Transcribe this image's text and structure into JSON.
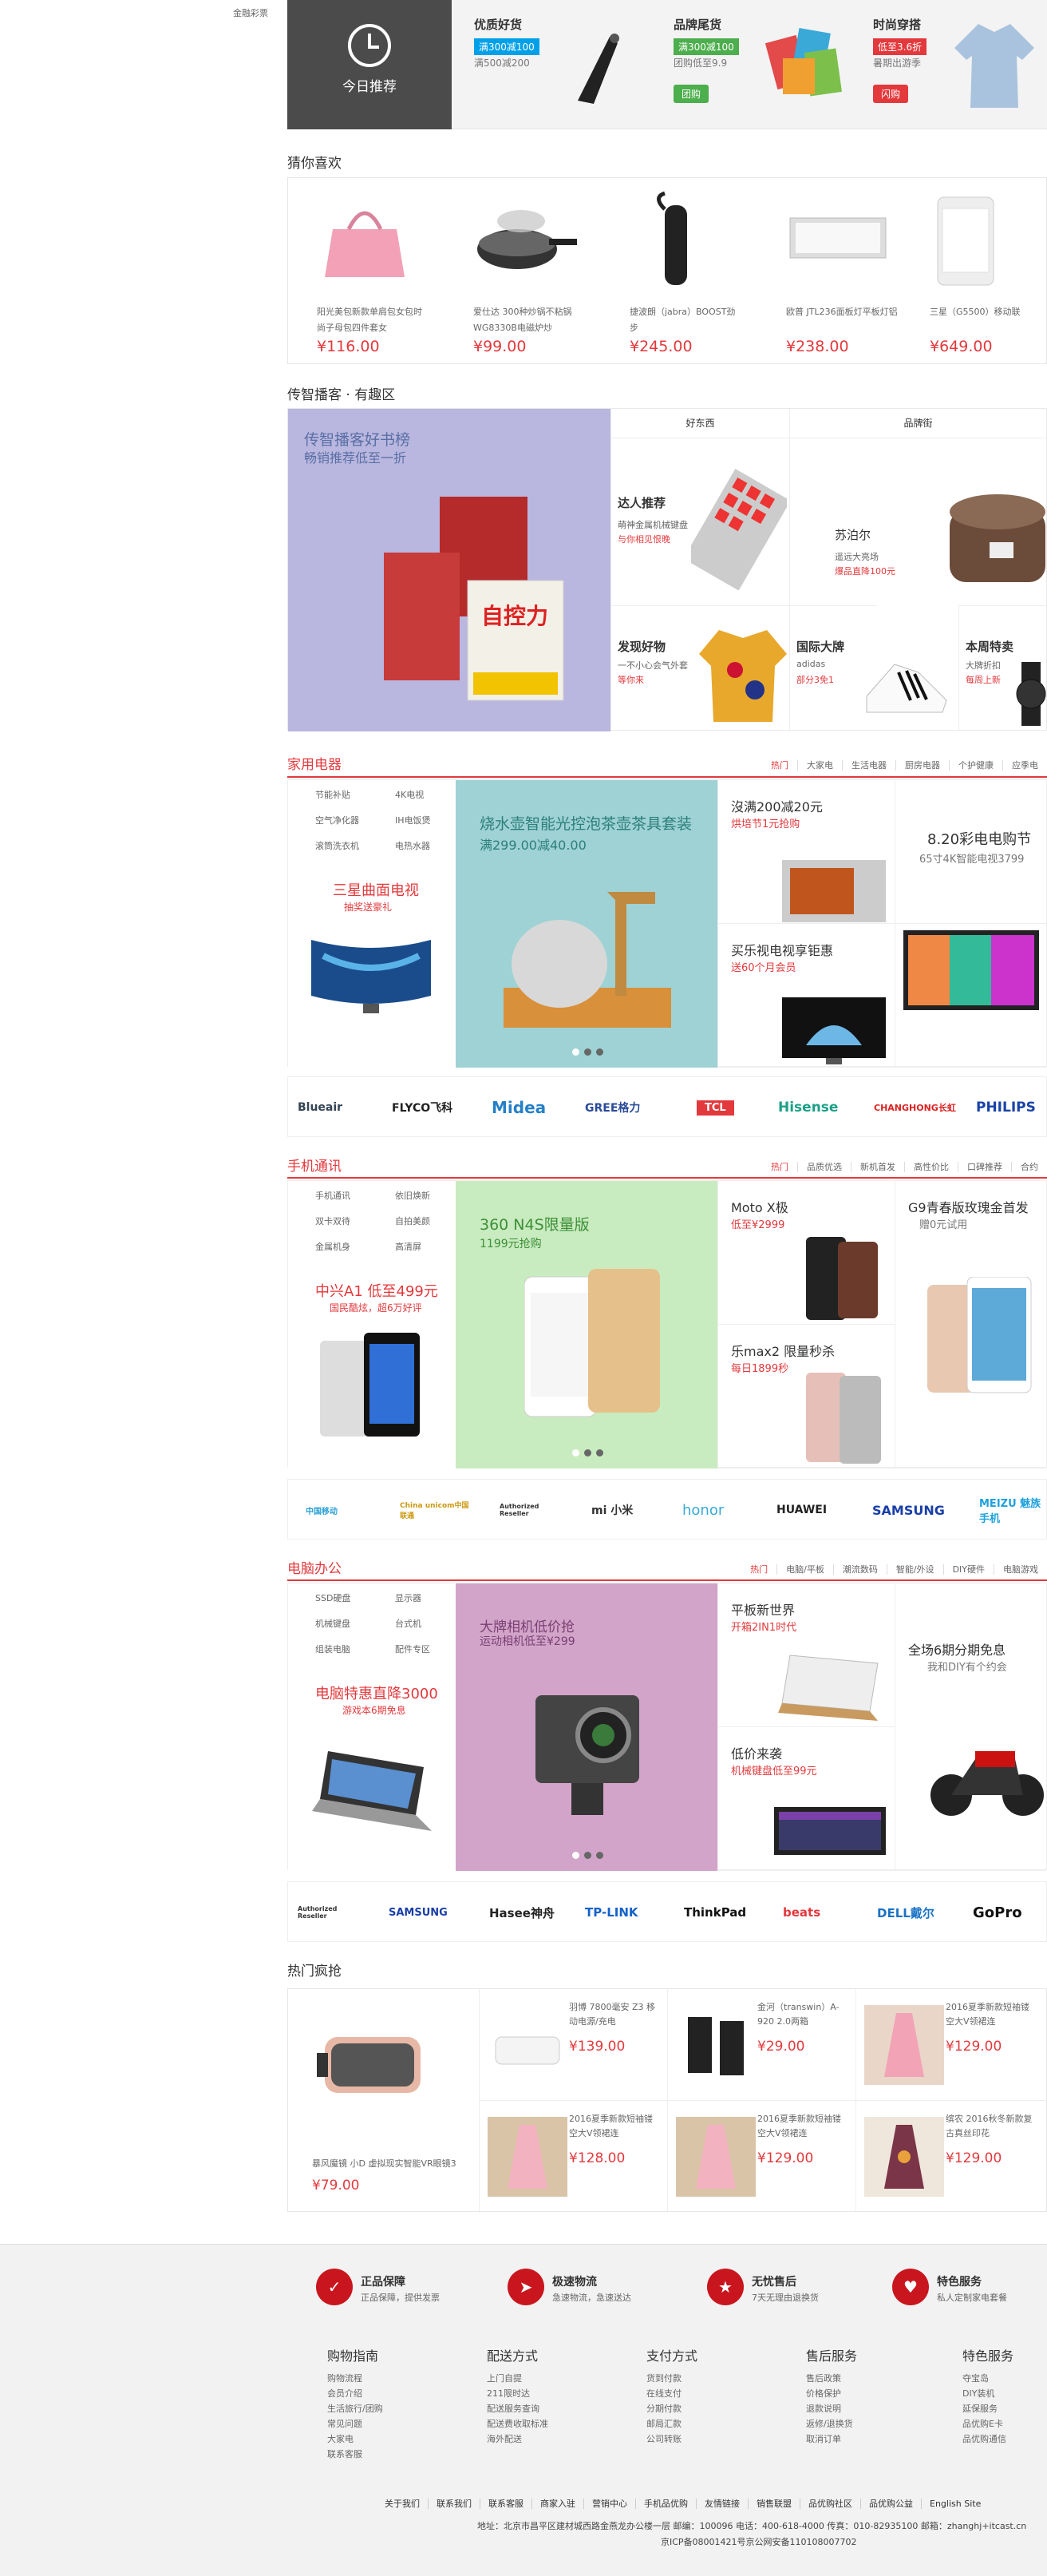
{
  "top_label": "金融彩票",
  "today": {
    "label": "今日推荐"
  },
  "promos": [
    {
      "title": "优质好货",
      "tag": "满300减100",
      "sub": "满500减200",
      "tag_color": "#00a0e9"
    },
    {
      "title": "品牌尾货",
      "tag": "满300减100",
      "sub": "团购低至9.9",
      "btn": "团购",
      "tag_color": "#4cae4c"
    },
    {
      "title": "时尚穿搭",
      "tag": "低至3.6折",
      "sub": "暑期出游季",
      "btn": "闪购",
      "tag_color": "#e3393c"
    }
  ],
  "guess": {
    "title": "猜你喜欢",
    "items": [
      {
        "name": "阳光美包新款单肩包女包时尚子母包四件套女",
        "price": "¥116.00"
      },
      {
        "name": "爱仕达 300种炒锅不粘锅WG8330B电磁炉炒",
        "price": "¥99.00"
      },
      {
        "name": "捷波朗（jabra）BOOST劲步",
        "price": "¥245.00"
      },
      {
        "name": "欧普 JTL236面板灯平板灯铝",
        "price": "¥238.00"
      },
      {
        "name": "三星（G5500）移动联",
        "price": "¥649.00"
      }
    ]
  },
  "media": {
    "title": "传智播客 · 有趣区",
    "banner": {
      "t1": "传智播客好书榜",
      "t2": "畅销推荐低至一折",
      "book": "自控力"
    },
    "col_heads": [
      "好东西",
      "品牌街"
    ],
    "cells": [
      {
        "a": "达人推荐",
        "b": "萌神金属机械键盘",
        "c": "与你相见恨晚"
      },
      {
        "a": "苏泊尔",
        "b": "遥远大亮场",
        "c": "爆品直降100元"
      },
      {
        "a": "发现好物",
        "b": "一不小心会气外套",
        "c": "等你来"
      },
      {
        "a": "国际大牌",
        "b": "adidas",
        "c": "部分3免1"
      },
      {
        "a": "本周特卖",
        "b": "大牌折扣",
        "c": "每周上新"
      }
    ]
  },
  "appliance": {
    "title": "家用电器",
    "tabs": [
      "热门",
      "大家电",
      "生活电器",
      "厨房电器",
      "个护健康",
      "应季电"
    ],
    "links": [
      "节能补贴",
      "4K电视",
      "空气净化器",
      "IH电饭煲",
      "滚筒洗衣机",
      "电热水器"
    ],
    "red_title": "三星曲面电视",
    "red_sub": "抽奖送豪礼",
    "mid": {
      "t1": "烧水壶智能光控泡茶壶茶具套装",
      "t2": "满299.00减40.00"
    },
    "right": [
      {
        "t1": "沒满200减20元",
        "t2": "烘培节1元抢购"
      },
      {
        "t1": "8.20彩电电购节",
        "t2": "65寸4K智能电视3799"
      },
      {
        "t1": "买乐视电视享钜惠",
        "t2": "送60个月会员"
      }
    ]
  },
  "appliance_brands": [
    "Blueair",
    "FLYCO飞科",
    "Midea",
    "GREE格力",
    "TCL",
    "Hisense",
    "CHANGHONG长虹",
    "PHILIPS"
  ],
  "phone": {
    "title": "手机通讯",
    "tabs": [
      "热门",
      "品质优选",
      "新机首发",
      "高性价比",
      "口碑推荐",
      "合约"
    ],
    "links": [
      "手机通讯",
      "依旧焕新",
      "双卡双待",
      "自拍美颜",
      "金属机身",
      "高清屏"
    ],
    "red_title": "中兴A1 低至499元",
    "red_sub": "国民酷炫，超6万好评",
    "mid": {
      "t1": "360 N4S限量版",
      "t2": "1199元抢购"
    },
    "right": [
      {
        "t1": "Moto X极",
        "t2": "低至¥2999"
      },
      {
        "t1": "G9青春版玫瑰金首发",
        "t2": "赠0元试用"
      },
      {
        "t1": "乐max2 限量秒杀",
        "t2": "每日1899秒"
      }
    ]
  },
  "phone_brands": [
    "中国移动",
    "China unicom中国联通",
    "Authorized Reseller",
    "mi 小米",
    "honor",
    "HUAWEI",
    "SAMSUNG",
    "MEIZU 魅族手机"
  ],
  "pc": {
    "title": "电脑办公",
    "tabs": [
      "热门",
      "电脑/平板",
      "潮流数码",
      "智能/外设",
      "DIY硬件",
      "电脑游戏"
    ],
    "links": [
      "SSD硬盘",
      "显示器",
      "机械键盘",
      "台式机",
      "组装电脑",
      "配件专区"
    ],
    "red_title": "电脑特惠直降3000",
    "red_sub": "游戏本6期免息",
    "mid": {
      "t1": "大牌相机低价抢",
      "t2": "运动相机低至¥299"
    },
    "right": [
      {
        "t1": "平板新世界",
        "t2": "开箱2IN1时代"
      },
      {
        "t1": "全场6期分期免息",
        "t2": "我和DIY有个约会"
      },
      {
        "t1": "低价来袭",
        "t2": "机械键盘低至99元"
      }
    ]
  },
  "pc_brands": [
    "Authorized Reseller",
    "SAMSUNG",
    "Hasee神舟",
    "TP-LINK",
    "ThinkPad",
    "beats",
    "DELL戴尔",
    "GoPro"
  ],
  "hot": {
    "title": "热门疯抢",
    "main": {
      "name": "暴风魔镜 小D 虚拟现实智能VR眼镜3",
      "price": "¥79.00"
    },
    "items": [
      {
        "name": "羽博 7800毫安 Z3 移动电源/充电",
        "price": "¥139.00"
      },
      {
        "name": "金河（transwin）A-920 2.0两箱",
        "price": "¥29.00"
      },
      {
        "name": "2016夏季新款短袖镂空大V领裙连",
        "price": "¥129.00"
      },
      {
        "name": "2016夏季新款短袖镂空大V领裙连",
        "price": "¥128.00"
      },
      {
        "name": "2016夏季新款短袖镂空大V领裙连",
        "price": "¥129.00"
      },
      {
        "name": "缤农 2016秋冬新款复古真丝印花",
        "price": "¥129.00"
      }
    ]
  },
  "services": [
    {
      "t": "正品保障",
      "s": "正品保障，提供发票"
    },
    {
      "t": "极速物流",
      "s": "急速物流，急速送达"
    },
    {
      "t": "无忧售后",
      "s": "7天无理由退换货"
    },
    {
      "t": "特色服务",
      "s": "私人定制家电套餐"
    }
  ],
  "footer_cols": [
    {
      "h": "购物指南",
      "l": [
        "购物流程",
        "会员介绍",
        "生活旅行/团购",
        "常见问题",
        "大家电",
        "联系客服"
      ]
    },
    {
      "h": "配送方式",
      "l": [
        "上门自提",
        "211限时达",
        "配送服务查询",
        "配送费收取标准",
        "海外配送"
      ]
    },
    {
      "h": "支付方式",
      "l": [
        "货到付款",
        "在线支付",
        "分期付款",
        "邮局汇款",
        "公司转账"
      ]
    },
    {
      "h": "售后服务",
      "l": [
        "售后政策",
        "价格保护",
        "退款说明",
        "返修/退换货",
        "取消订单"
      ]
    },
    {
      "h": "特色服务",
      "l": [
        "夺宝岛",
        "DIY装机",
        "延保服务",
        "品优购E卡",
        "品优购通信"
      ]
    }
  ],
  "footer_links": [
    "关于我们",
    "联系我们",
    "联系客服",
    "商家入驻",
    "营销中心",
    "手机品优购",
    "友情链接",
    "销售联盟",
    "品优购社区",
    "品优购公益",
    "English Site"
  ],
  "footer_addr": "地址：北京市昌平区建材城西路金燕龙办公楼一层 邮编：100096 电话：400-618-4000 传真：010-82935100 邮箱：zhanghj+itcast.cn",
  "footer_icp": "京ICP备08001421号京公网安备110108007702",
  "colors": {
    "red": "#e3393c",
    "dark": "#4b4b4b",
    "media_bg": "#b9b7df",
    "app_mid": "#9ed2d5",
    "phone_mid": "#c9ebc0",
    "pc_mid": "#d2a4c9"
  }
}
